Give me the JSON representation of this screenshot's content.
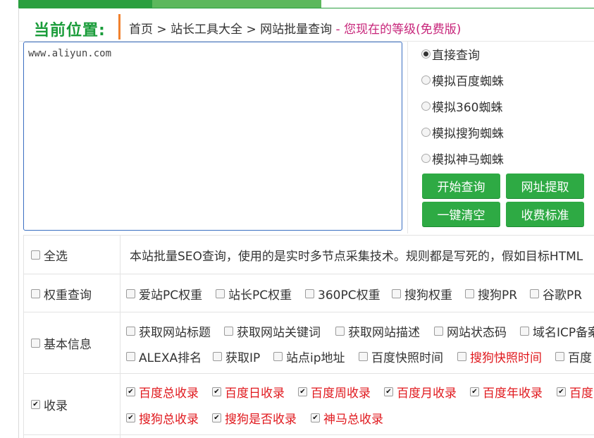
{
  "location": {
    "title": "当前位置:",
    "crumbs": [
      "首页",
      "站长工具大全",
      "网站批量查询"
    ],
    "separator": ">",
    "dash": "-",
    "level_text": "您现在的等级(免费版)"
  },
  "input": {
    "value": "www.aliyun.com"
  },
  "radios": [
    {
      "label": "直接查询",
      "checked": true
    },
    {
      "label": "模拟百度蜘蛛",
      "checked": false
    },
    {
      "label": "模拟360蜘蛛",
      "checked": false
    },
    {
      "label": "模拟搜狗蜘蛛",
      "checked": false
    },
    {
      "label": "模拟神马蜘蛛",
      "checked": false
    }
  ],
  "buttons": {
    "start": "开始查询",
    "extract": "网址提取",
    "clear": "一键清空",
    "pricing": "收费标准"
  },
  "select_all": {
    "label": "全选",
    "checked": false
  },
  "description": "本站批量SEO查询，使用的是实时多节点采集技术。规则都是写死的，假如目标HTML",
  "groups": {
    "weight": {
      "label": "权重查询",
      "options": [
        "爱站PC权重",
        "站长PC权重",
        "360PC权重",
        "搜狗权重",
        "搜狗PR",
        "谷歌PR"
      ]
    },
    "basic": {
      "label": "基本信息",
      "row1": [
        "获取网站标题",
        "获取网站关键词",
        "获取网站描述",
        "网站状态码",
        "域名ICP备案"
      ],
      "row2": [
        "ALEXA排名",
        "获取IP",
        "站点ip地址",
        "百度快照时间",
        "搜狗快照时间",
        "百度"
      ]
    },
    "index": {
      "label": "收录",
      "row1": [
        "百度总收录",
        "百度日收录",
        "百度周收录",
        "百度月收录",
        "百度年收录",
        "百度"
      ],
      "row2": [
        "搜狗总收录",
        "搜狗是否收录",
        "神马总收录"
      ]
    }
  },
  "colors": {
    "green": "#2eaa44",
    "accent_orange": "#f0812e",
    "red": "#e0191e",
    "pink": "#c7257a"
  }
}
